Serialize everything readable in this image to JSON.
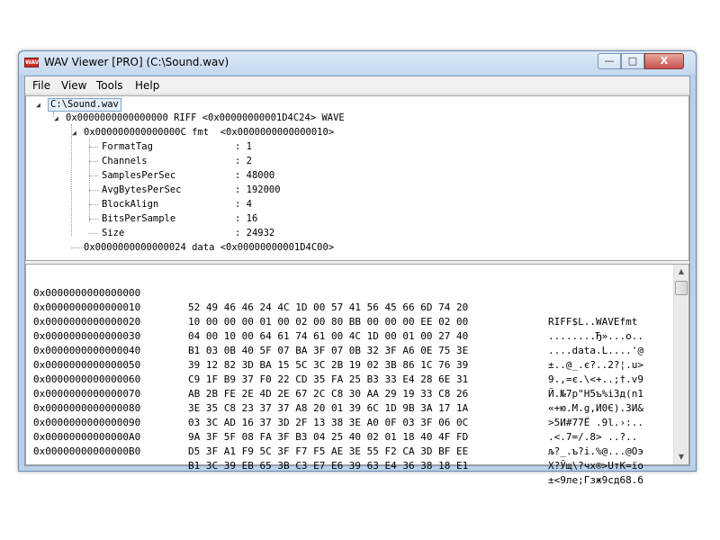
{
  "window": {
    "title": "WAV Viewer [PRO] (C:\\Sound.wav)",
    "icon": "wav-app-icon",
    "icon_text": "WAV"
  },
  "controls": {
    "minimize": "—",
    "maximize": "□",
    "close": "X"
  },
  "menu": [
    {
      "label": "File"
    },
    {
      "label": "View"
    },
    {
      "label": "Tools"
    },
    {
      "label": "Help"
    }
  ],
  "tree": {
    "root": "C:\\Sound.wav",
    "riff": "0x0000000000000000 RIFF <0x00000000001D4C24> WAVE",
    "fmt": "0x000000000000000C fmt  <0x0000000000000010>",
    "fields": [
      {
        "name": "FormatTag",
        "value": ": 1"
      },
      {
        "name": "Channels",
        "value": ": 2"
      },
      {
        "name": "SamplesPerSec",
        "value": ": 48000"
      },
      {
        "name": "AvgBytesPerSec",
        "value": ": 192000"
      },
      {
        "name": "BlockAlign",
        "value": ": 4"
      },
      {
        "name": "BitsPerSample",
        "value": ": 16"
      },
      {
        "name": "Size",
        "value": ": 24932"
      }
    ],
    "data": "0x0000000000000024 data <0x00000000001D4C00>"
  },
  "hex_rows": [
    {
      "addr": "0x0000000000000000",
      "bytes": "52 49 46 46 24 4C 1D 00 57 41 56 45 66 6D 74 20",
      "ascii": "RIFF$L..WAVEfmt"
    },
    {
      "addr": "0x0000000000000010",
      "bytes": "10 00 00 00 01 00 02 00 80 BB 00 00 00 EE 02 00",
      "ascii": "........Ђ»...о.."
    },
    {
      "addr": "0x0000000000000020",
      "bytes": "04 00 10 00 64 61 74 61 00 4C 1D 00 01 00 27 40",
      "ascii": "....data.L....'@"
    },
    {
      "addr": "0x0000000000000030",
      "bytes": "B1 03 0B 40 5F 07 BA 3F 07 0B 32 3F A6 0E 75 3E",
      "ascii": "±..@_.є?..2?¦.u>"
    },
    {
      "addr": "0x0000000000000040",
      "bytes": "39 12 82 3D BA 15 5C 3C 2B 19 02 3B 86 1C 76 39",
      "ascii": "9.‚=є.\\<+..;†.v9"
    },
    {
      "addr": "0x0000000000000050",
      "bytes": "C9 1F B9 37 F0 22 CD 35 FA 25 B3 33 E4 28 6E 31",
      "ascii": "Й.№7р\"Н5ъ%і3д(n1"
    },
    {
      "addr": "0x0000000000000060",
      "bytes": "AB 2B FE 2E 4D 2E 67 2C C8 30 AA 29 19 33 C8 26",
      "ascii": "«+ю.M.g,И0Є).3И&"
    },
    {
      "addr": "0x0000000000000070",
      "bytes": "3E 35 C8 23 37 37 A8 20 01 39 6C 1D 9B 3A 17 1A",
      "ascii": ">5И#77Ё .9l.›:.."
    },
    {
      "addr": "0x0000000000000080",
      "bytes": "03 3C AD 16 37 3D 2F 13 38 3E A0 0F 03 3F 06 0C",
      "ascii": ".<­.7=/.8> ..?.."
    },
    {
      "addr": "0x0000000000000090",
      "bytes": "9A 3F 5F 08 FA 3F B3 04 25 40 02 01 18 40 4F FD",
      "ascii": "љ?_.ъ?і.%@...@Oэ"
    },
    {
      "addr": "0x00000000000000A0",
      "bytes": "D5 3F A1 F9 5C 3F F7 F5 AE 3E 55 F2 CA 3D BF EE",
      "ascii": "Х?Ўщ\\?чх®>UтК=їо"
    },
    {
      "addr": "0x00000000000000B0",
      "bytes": "B1 3C 39 EB 65 3B C3 E7 E6 39 63 E4 36 38 18 E1",
      "ascii": "±<9лe;Гзж9cд68.б"
    }
  ]
}
